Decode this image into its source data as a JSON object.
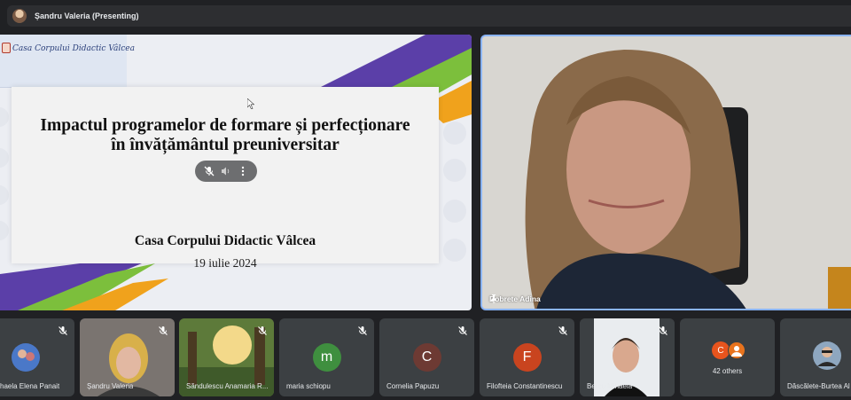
{
  "header": {
    "presenter_label": "Șandru Valeria (Presenting)"
  },
  "slide": {
    "logo_text": "Casa Corpului Didactic Vâlcea",
    "title_line1": "Impactul programelor de formare și perfecționare",
    "title_line2": "în învățământul preuniversitar",
    "subtitle": "Casa Corpului Didactic Vâlcea",
    "date": "19 iulie 2024"
  },
  "speaker": {
    "name": "Dobrete Adina"
  },
  "participants": [
    {
      "name": "haela Elena Panait"
    },
    {
      "name": "Șandru Valeria"
    },
    {
      "name": "Săndulescu Anamaria R..."
    },
    {
      "name": "maria schiopu",
      "initial": "m",
      "color": "#3f8f3f"
    },
    {
      "name": "Cornelia Papuzu",
      "initial": "C",
      "color": "#6d3a33"
    },
    {
      "name": "Filofteia Constantinescu",
      "initial": "F",
      "color": "#c9441f"
    },
    {
      "name": "Bercu Mihaela"
    },
    {
      "name": "42 others",
      "initial": "C",
      "color": "#e8541d"
    },
    {
      "name": "Dăscălete-Burtea Al"
    }
  ]
}
